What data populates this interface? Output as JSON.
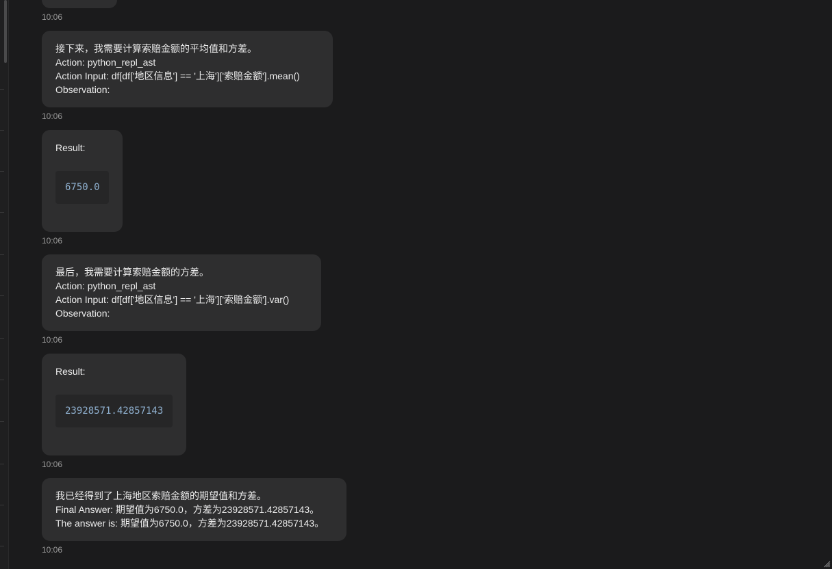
{
  "messages": [
    {
      "lines": [
        "接下来，我需要计算索赔金额的平均值和方差。",
        "Action: python_repl_ast",
        "Action Input: df[df['地区信息'] == '上海']['索赔金额'].mean()",
        "Observation:"
      ],
      "time": "10:06"
    },
    {
      "label": "Result:",
      "code": "6750.0",
      "time": "10:06"
    },
    {
      "lines": [
        "最后，我需要计算索赔金额的方差。",
        "Action: python_repl_ast",
        "Action Input: df[df['地区信息'] == '上海']['索赔金额'].var()",
        "Observation:"
      ],
      "time": "10:06"
    },
    {
      "label": "Result:",
      "code": "23928571.42857143",
      "time": "10:06"
    },
    {
      "lines": [
        "我已经得到了上海地区索赔金额的期望值和方差。",
        "Final Answer: 期望值为6750.0，方差为23928571.42857143。",
        "The answer is: 期望值为6750.0，方差为23928571.42857143。"
      ],
      "time": "10:06"
    }
  ],
  "previous_message": {
    "time": "10:06"
  },
  "icons": {
    "resize": "resize-corner-icon"
  }
}
